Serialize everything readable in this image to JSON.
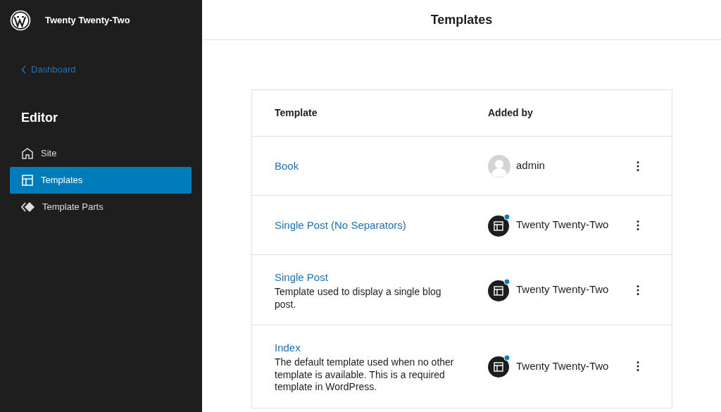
{
  "site": {
    "title": "Twenty Twenty-Two"
  },
  "back_link": {
    "label": "Dashboard"
  },
  "sidebar": {
    "heading": "Editor",
    "items": [
      {
        "label": "Site",
        "kind": "home",
        "selected": false
      },
      {
        "label": "Templates",
        "kind": "layout",
        "selected": true
      },
      {
        "label": "Template Parts",
        "kind": "parts",
        "selected": false
      }
    ]
  },
  "page": {
    "title": "Templates"
  },
  "table": {
    "columns": [
      "Template",
      "Added by"
    ],
    "rows": [
      {
        "name": "Book",
        "author": "admin",
        "kind": "user"
      },
      {
        "name": "Single Post (No Separators)",
        "author": "Twenty Twenty-Two",
        "kind": "theme"
      },
      {
        "name": "Single Post",
        "description": "Template used to display a single blog post.",
        "author": "Twenty Twenty-Two",
        "kind": "theme"
      },
      {
        "name": "Index",
        "description": "The default template used when no other template is available. This is a required template in WordPress.",
        "author": "Twenty Twenty-Two",
        "kind": "theme"
      }
    ]
  }
}
